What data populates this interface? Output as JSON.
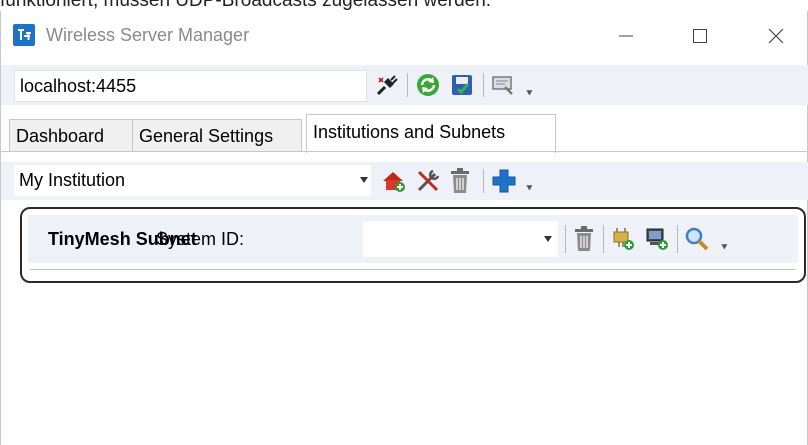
{
  "caption": "funktioniert, müssen UDP-Broadcasts zugelassen werden.",
  "window": {
    "title": "Wireless Server Manager",
    "icon": "app-network-icon",
    "controls": [
      "minimize-icon",
      "maximize-icon",
      "close-icon"
    ]
  },
  "server": {
    "address": "localhost:4455",
    "toolbar": [
      "disconnect-plug-icon",
      "refresh-icon",
      "save-icon",
      "settings-monitor-icon"
    ]
  },
  "tabs": [
    {
      "label": "Dashboard",
      "active": false
    },
    {
      "label": "General Settings",
      "active": false
    },
    {
      "label": "Institutions and Subnets",
      "active": true
    }
  ],
  "institution": {
    "selected": "My Institution",
    "toolbar": [
      "add-house-icon",
      "tools-icon",
      "trash-icon",
      "add-icon"
    ]
  },
  "subnet": {
    "title": "TinyMesh Subnet",
    "system_id_label": "System ID:",
    "system_id_value": "",
    "toolbar": [
      "trash-icon",
      "add-gateway-icon",
      "add-device-icon",
      "search-icon"
    ]
  },
  "colors": {
    "toolbar_background": "#eef2f8",
    "accent_blue": "#1e73c8",
    "title_gray": "#8a8a8a"
  }
}
